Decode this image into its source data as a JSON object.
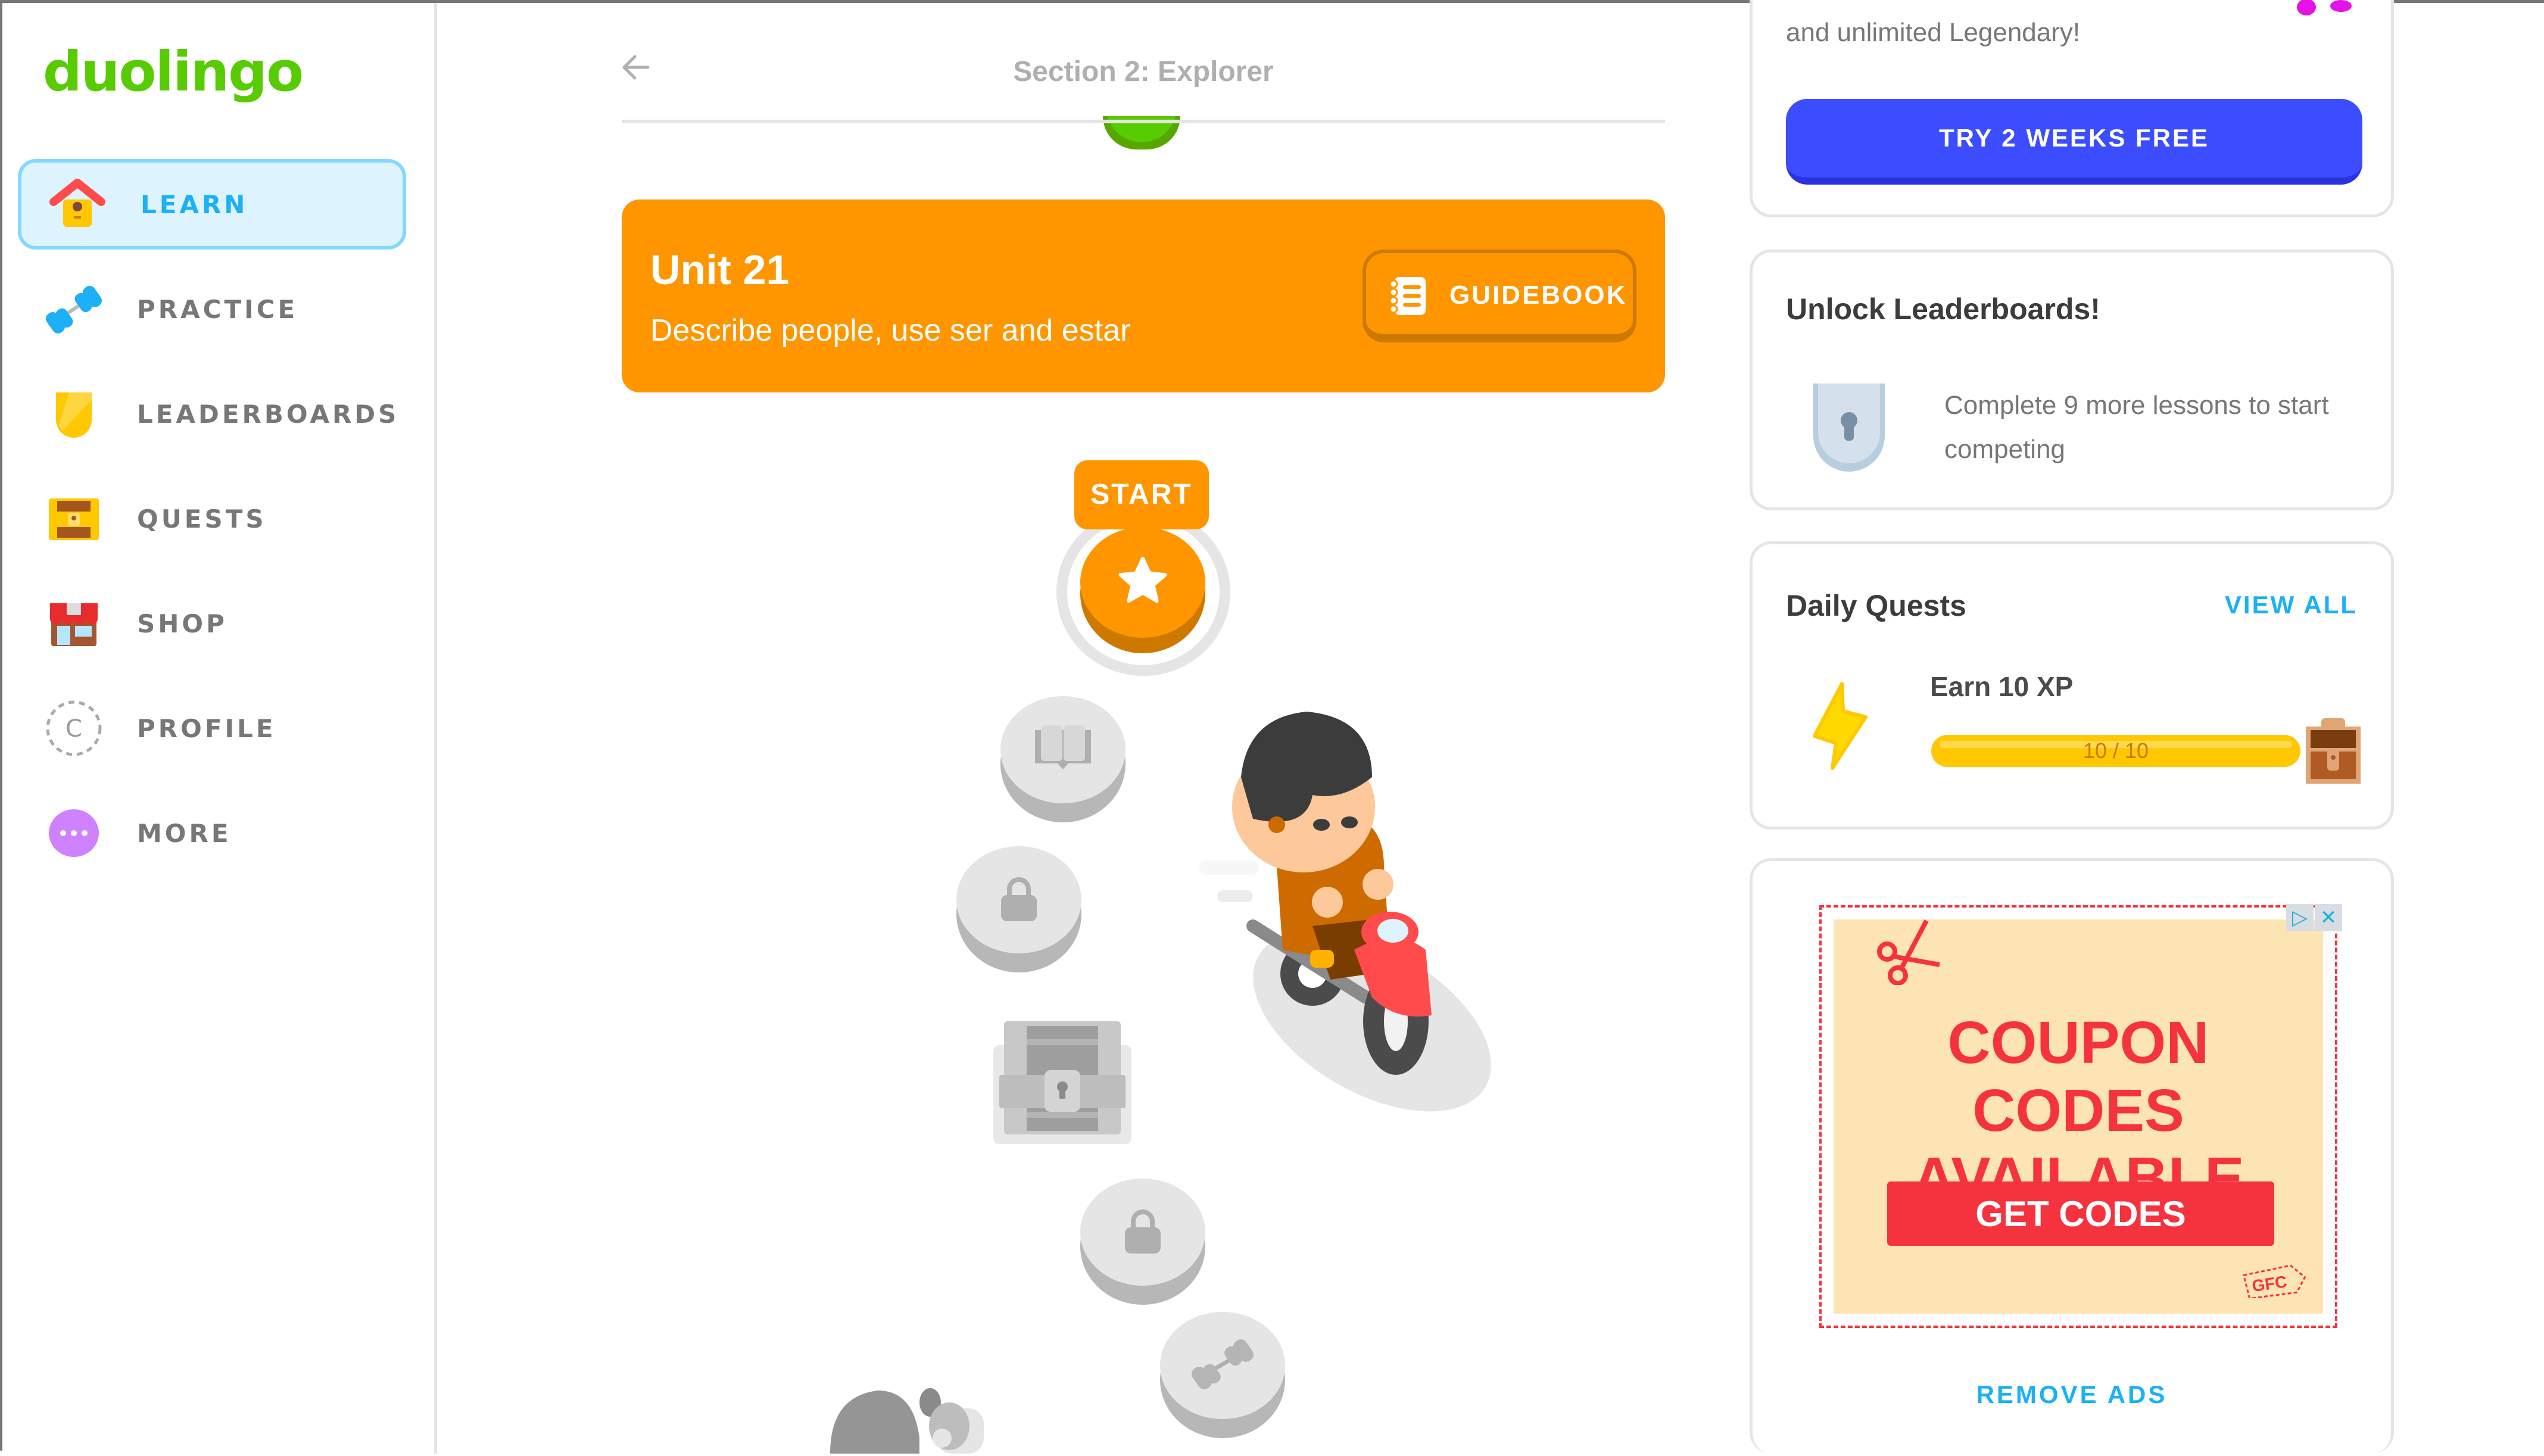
{
  "app": {
    "logo_text": "duolingo"
  },
  "colors": {
    "brand_green": "#58cc02",
    "active_blue": "#1cb0f6",
    "unit_orange": "#ff9600",
    "super_blue": "#3c4dff",
    "ad_red": "#f5333f",
    "quest_yellow": "#ffc800"
  },
  "sidebar": {
    "items": [
      {
        "label": "LEARN",
        "icon": "house-icon",
        "active": true
      },
      {
        "label": "PRACTICE",
        "icon": "dumbbell-icon",
        "active": false
      },
      {
        "label": "LEADERBOARDS",
        "icon": "shield-icon",
        "active": false
      },
      {
        "label": "QUESTS",
        "icon": "treasure-chest-icon",
        "active": false
      },
      {
        "label": "SHOP",
        "icon": "shop-icon",
        "active": false
      },
      {
        "label": "PROFILE",
        "icon": "avatar-icon",
        "avatar_letter": "C",
        "active": false
      },
      {
        "label": "MORE",
        "icon": "more-icon",
        "active": false
      }
    ]
  },
  "main": {
    "section_title": "Section 2: Explorer",
    "back_icon": "arrow-left-icon",
    "unit": {
      "title": "Unit 21",
      "description": "Describe people, use ser and estar",
      "guidebook_label": "GUIDEBOOK"
    },
    "path": {
      "start_label": "START",
      "nodes": [
        {
          "type": "lesson",
          "state": "current",
          "icon": "star-icon"
        },
        {
          "type": "story",
          "state": "locked",
          "icon": "book-icon"
        },
        {
          "type": "lesson",
          "state": "locked",
          "icon": "lock-icon"
        },
        {
          "type": "chest",
          "state": "locked",
          "icon": "treasure-chest-icon"
        },
        {
          "type": "lesson",
          "state": "locked",
          "icon": "lock-icon"
        },
        {
          "type": "practice",
          "state": "locked",
          "icon": "dumbbell-icon"
        }
      ]
    }
  },
  "right": {
    "super": {
      "text": "and unlimited Legendary!",
      "button_label": "TRY 2 WEEKS FREE"
    },
    "leaderboards": {
      "title": "Unlock Leaderboards!",
      "text": "Complete 9 more lessons to start competing"
    },
    "daily_quests": {
      "title": "Daily Quests",
      "view_all": "VIEW ALL",
      "quests": [
        {
          "name": "Earn 10 XP",
          "progress_text": "10 / 10",
          "current": 10,
          "total": 10
        }
      ]
    },
    "ad": {
      "headline_line1": "COUPON CODES",
      "headline_line2": "AVAILABLE",
      "button_label": "GET CODES",
      "logo_text": "GFC",
      "remove_ads_label": "REMOVE ADS"
    }
  }
}
